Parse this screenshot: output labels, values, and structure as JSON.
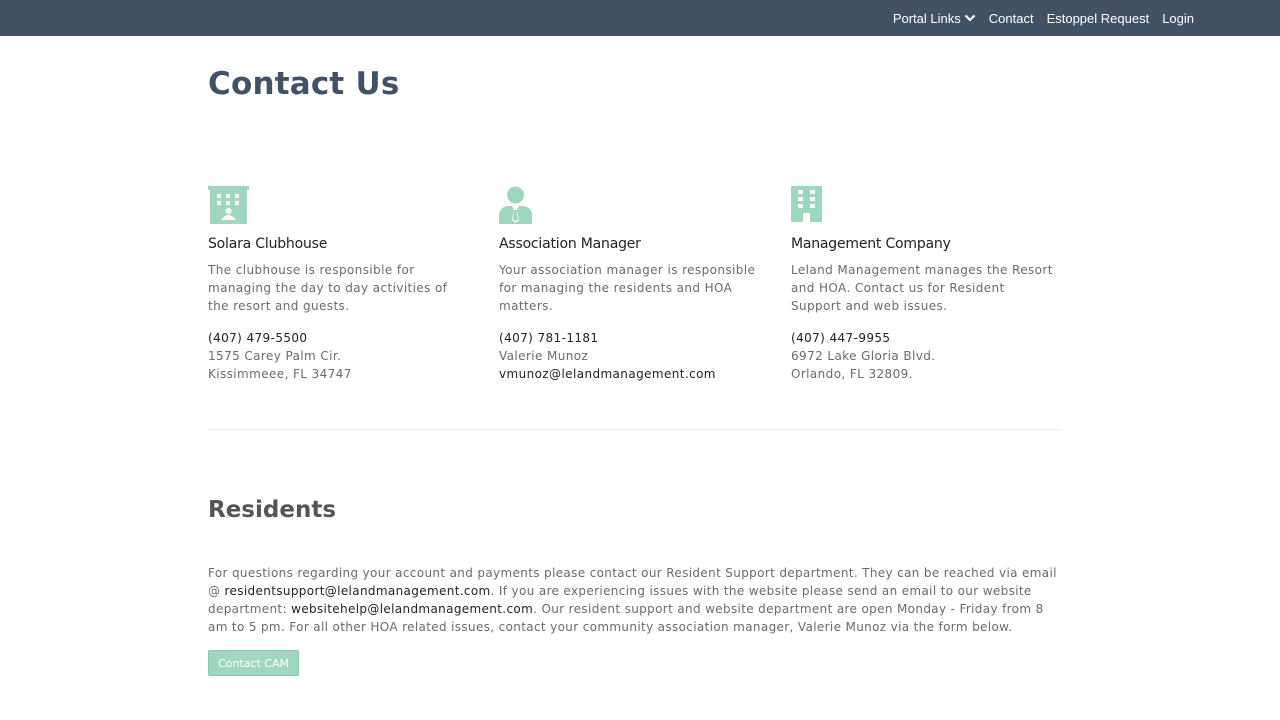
{
  "colors": {
    "nav_bg": "#435166",
    "accent_green": "#9fd6bf",
    "title": "#435166"
  },
  "nav": {
    "portal_links": "Portal Links",
    "contact": "Contact",
    "estoppel": "Estoppel Request",
    "login": "Login"
  },
  "page": {
    "title": "Contact Us"
  },
  "contacts": [
    {
      "icon": "hotel-building-icon",
      "title": "Solara Clubhouse",
      "description": "The clubhouse is responsible for managing the day to day activities of the resort and guests.",
      "phone": "(407) 479-5500",
      "line2": "1575 Carey Palm Cir.",
      "line3": "Kissimmeee, FL 34747"
    },
    {
      "icon": "user-tie-icon",
      "title": "Association Manager",
      "description": "Your association manager is responsible for managing the residents and HOA matters.",
      "phone": "(407) 781-1181",
      "line2": "Valerie Munoz",
      "line3": "vmunoz@lelandmanagement.com"
    },
    {
      "icon": "office-building-icon",
      "title": "Management Company",
      "description": "Leland Management manages the Resort and HOA. Contact us for Resident Support and web issues.",
      "phone": "(407) 447-9955",
      "line2": "6972 Lake Gloria Blvd.",
      "line3": "Orlando, FL 32809."
    }
  ],
  "residents": {
    "title": "Residents",
    "text_1": "For questions regarding your account and payments please contact our Resident Support department. They can be reached via email @ ",
    "email_support": "residentsupport@lelandmanagement.com",
    "text_2": ". If you are experiencing issues with the website please send an email to our website department: ",
    "email_web": "websitehelp@lelandmanagement.com",
    "text_3": ". Our resident support and website department are open Monday - Friday from 8 am to 5 pm. For all other HOA related issues, contact your community association manager, Valerie Munoz via the form below.",
    "button": "Contact CAM"
  }
}
